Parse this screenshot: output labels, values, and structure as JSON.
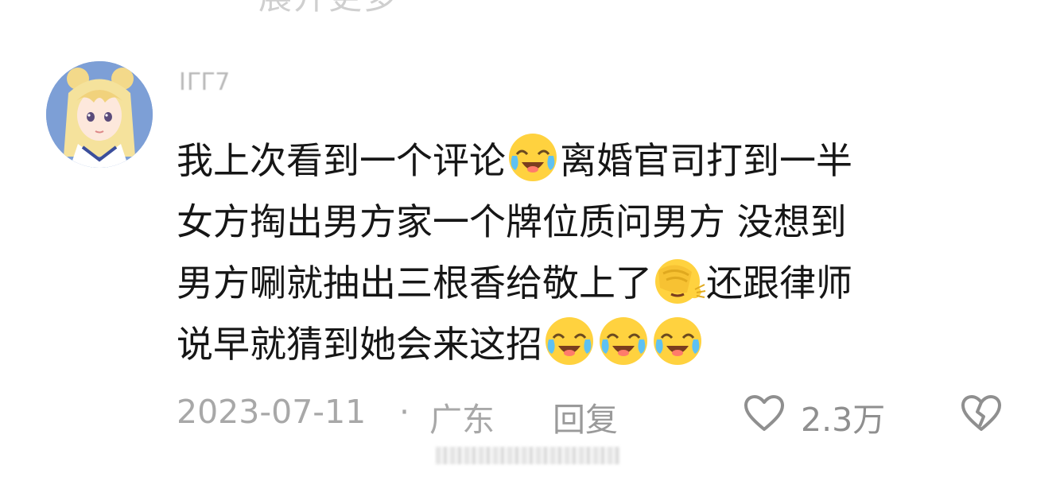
{
  "top_text": "展开更多",
  "comment": {
    "username": "ⅠΓΓ7",
    "text_line1_a": "我上次看到一个评论",
    "text_line1_b": "离婚官司打到一半",
    "text_line2": "女方掏出男方家一个牌位质问男方 没想到",
    "text_line3_a": "男方唰就抽出三根香给敬上了",
    "text_line3_b": "还跟律师",
    "text_line4": "说早就猜到她会来这招",
    "emojis": [
      "laugh-cry-emoji",
      "facepalm-emoji",
      "laugh-cry-emoji",
      "laugh-cry-emoji",
      "laugh-cry-emoji"
    ]
  },
  "meta": {
    "date": "2023-07-11",
    "separator": "·",
    "region": "广东",
    "reply_label": "回复",
    "like_count": "2.3万"
  },
  "icons": {
    "like": "heart-outline-icon",
    "dislike": "broken-heart-icon"
  },
  "colors": {
    "text": "#161616",
    "meta_gray": "#a8a8a8",
    "avatar_bg": "#7d9fd6"
  }
}
